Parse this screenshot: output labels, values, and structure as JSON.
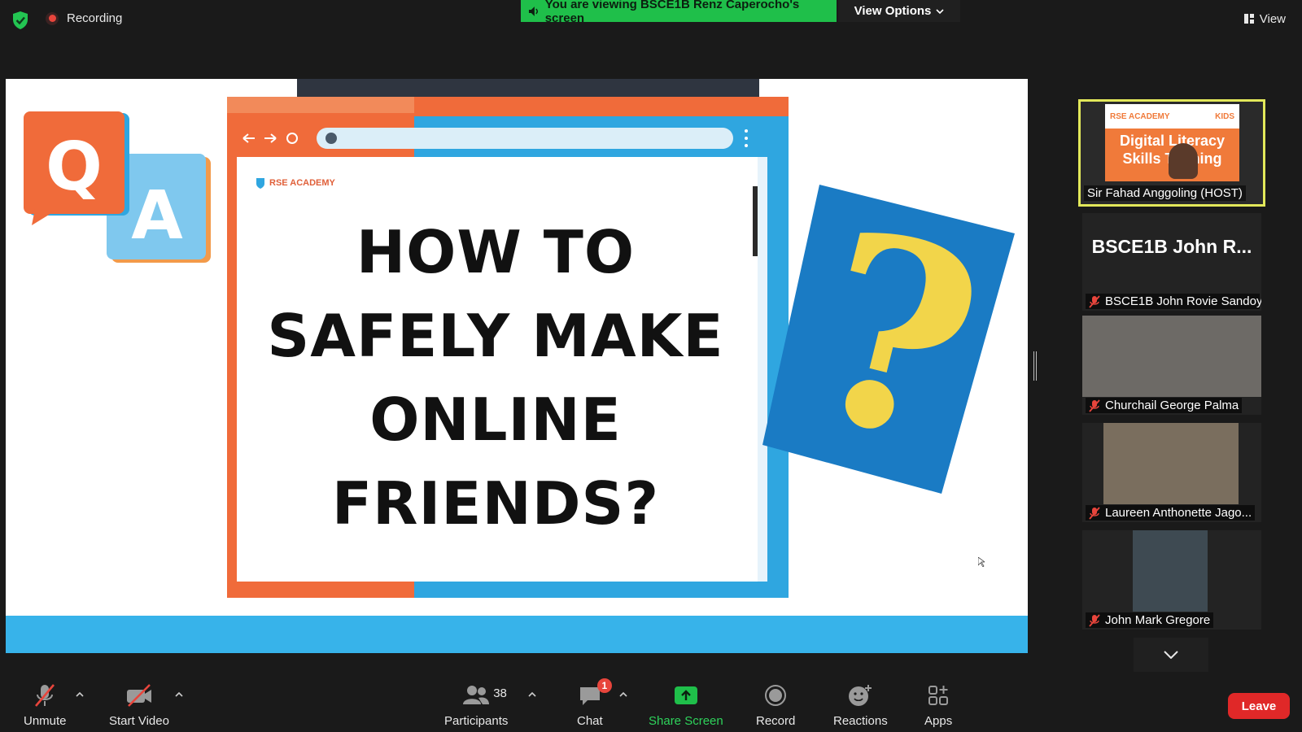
{
  "top_bar": {
    "recording_label": "Recording",
    "viewing_banner": "You are viewing BSCE1B Renz Caperocho's screen",
    "view_options_label": "View Options",
    "view_label": "View"
  },
  "shared_screen": {
    "slide_title_lines": [
      "HOW TO",
      "SAFELY MAKE",
      "ONLINE",
      "FRIENDS?"
    ],
    "qa_letters": [
      "Q",
      "A"
    ],
    "question_mark": "?",
    "small_logo": "RSE ACADEMY"
  },
  "gallery": {
    "host": {
      "name": "Sir Fahad Anggoling (HOST)",
      "poster_brand": "RSE ACADEMY",
      "poster_badge": "KIDS",
      "poster_title_1": "Digital Literacy",
      "poster_title_2": "Skills Training"
    },
    "participants": [
      {
        "display_text": "BSCE1B John R...",
        "name": "BSCE1B John Rovie Sandoy"
      },
      {
        "name": "Churchail George Palma"
      },
      {
        "name": "Laureen Anthonette Jago..."
      },
      {
        "name": "John Mark Gregore"
      }
    ]
  },
  "toolbar": {
    "unmute_label": "Unmute",
    "start_video_label": "Start Video",
    "participants_label": "Participants",
    "participants_count": "38",
    "chat_label": "Chat",
    "chat_badge": "1",
    "share_screen_label": "Share Screen",
    "record_label": "Record",
    "reactions_label": "Reactions",
    "apps_label": "Apps",
    "leave_label": "Leave"
  },
  "colors": {
    "banner_green": "#1fbf4a",
    "share_green": "#1fbf4a",
    "leave_red": "#e02828",
    "host_border": "#e2e85a",
    "slide_blue": "#37b3ea",
    "slide_orange": "#f06b3a"
  }
}
